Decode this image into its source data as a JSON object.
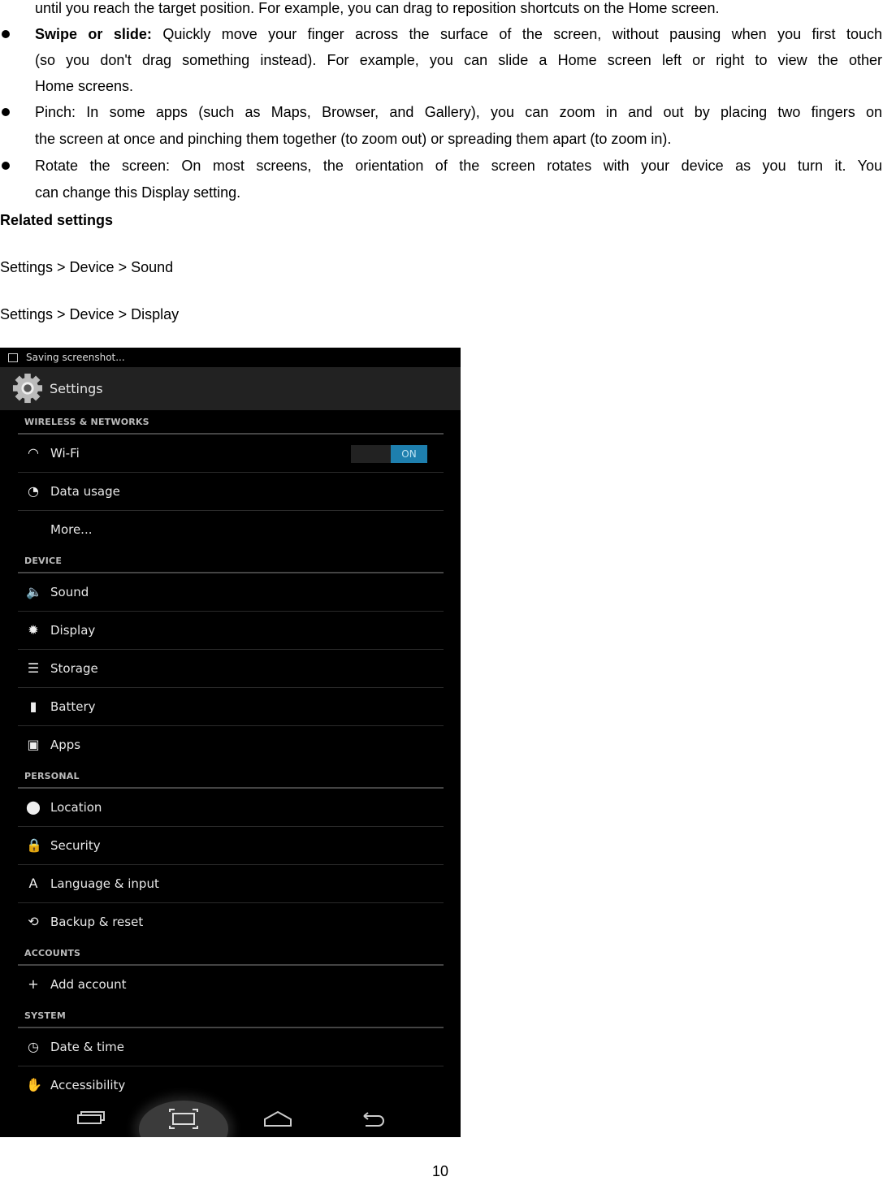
{
  "text": {
    "line0": "until you reach the target position. For example, you can drag to reposition shortcuts on the Home screen.",
    "swipe": {
      "term": "Swipe or slide:",
      "line1": "Quickly move your finger across the surface of the screen, without pausing when you first touch",
      "line2": "(so you don't drag something instead). For example, you can slide a Home screen left or right to view the other",
      "line3": "Home screens."
    },
    "pinch": {
      "line1": "Pinch: In some apps (such as Maps, Browser, and Gallery), you can zoom in and out by placing two fingers on",
      "line2": "the screen at once and pinching them together (to zoom out) or spreading them apart (to zoom in)."
    },
    "rotate": {
      "line1": "Rotate the screen: On most screens, the orientation of the screen rotates with your device as you turn it. You",
      "line2": "can change this Display setting."
    },
    "related_heading": "Related settings",
    "related": [
      "Settings > Device > Sound",
      "Settings > Device > Display"
    ],
    "page_number": "10"
  },
  "screenshot": {
    "status_text": "Saving screenshot...",
    "title": "Settings",
    "accent": "#1e7fae",
    "sections": [
      {
        "header": "WIRELESS & NETWORKS",
        "items": [
          {
            "label": "Wi-Fi",
            "icon": "wifi-icon",
            "toggle": "ON"
          },
          {
            "label": "Data usage",
            "icon": "data-usage-icon"
          },
          {
            "label": "More...",
            "icon": ""
          }
        ]
      },
      {
        "header": "DEVICE",
        "items": [
          {
            "label": "Sound",
            "icon": "speaker-icon"
          },
          {
            "label": "Display",
            "icon": "brightness-icon"
          },
          {
            "label": "Storage",
            "icon": "storage-icon"
          },
          {
            "label": "Battery",
            "icon": "battery-icon"
          },
          {
            "label": "Apps",
            "icon": "apps-icon"
          }
        ]
      },
      {
        "header": "PERSONAL",
        "items": [
          {
            "label": "Location",
            "icon": "location-pin-icon"
          },
          {
            "label": "Security",
            "icon": "lock-icon"
          },
          {
            "label": "Language & input",
            "icon": "language-icon"
          },
          {
            "label": "Backup & reset",
            "icon": "backup-icon"
          }
        ]
      },
      {
        "header": "ACCOUNTS",
        "items": [
          {
            "label": "Add account",
            "icon": "plus-icon"
          }
        ]
      },
      {
        "header": "SYSTEM",
        "items": [
          {
            "label": "Date & time",
            "icon": "clock-icon"
          },
          {
            "label": "Accessibility",
            "icon": "hand-icon"
          }
        ]
      }
    ]
  }
}
